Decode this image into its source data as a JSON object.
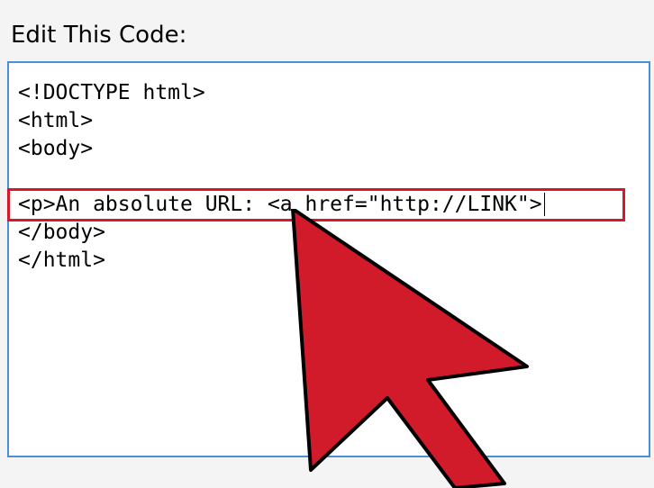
{
  "heading": "Edit This Code:",
  "code": {
    "line1": "<!DOCTYPE html>",
    "line2": "<html>",
    "line3": "<body>",
    "line5": "<p>An absolute URL: <a href=\"http://LINK\">",
    "line6": "</body>",
    "line7": "</html>"
  }
}
